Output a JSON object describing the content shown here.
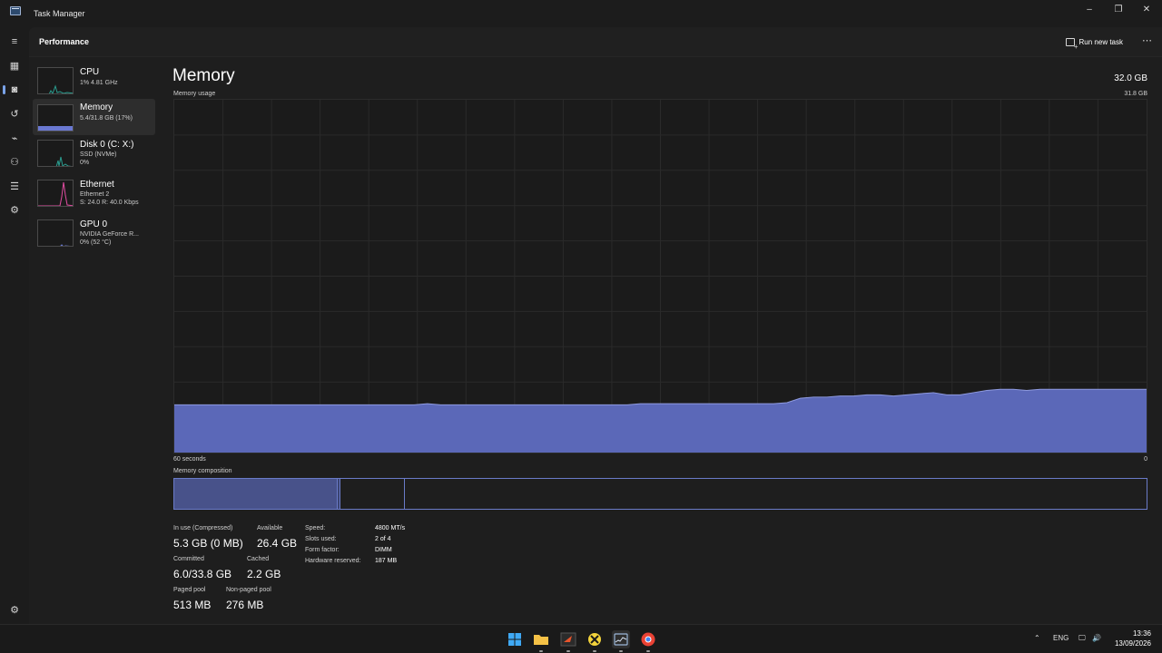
{
  "window": {
    "title": "Task Manager",
    "controls": {
      "minimize": "–",
      "restore": "❐",
      "close": "✕"
    }
  },
  "nav": [
    {
      "name": "hamburger-icon",
      "glyph": "≡"
    },
    {
      "name": "processes-icon",
      "glyph": "▦"
    },
    {
      "name": "performance-icon",
      "glyph": "◙",
      "active": true
    },
    {
      "name": "app-history-icon",
      "glyph": "↺"
    },
    {
      "name": "startup-apps-icon",
      "glyph": "⌁"
    },
    {
      "name": "users-icon",
      "glyph": "⚇"
    },
    {
      "name": "details-icon",
      "glyph": "☰"
    },
    {
      "name": "services-icon",
      "glyph": "⚙"
    }
  ],
  "settings_glyph": "⚙",
  "header": {
    "title": "Performance",
    "run_new_task": "Run new task",
    "more": "⋯"
  },
  "devices": [
    {
      "name": "CPU",
      "sub1": "1% 4.81 GHz",
      "sub2": ""
    },
    {
      "name": "Memory",
      "sub1": "5.4/31.8 GB (17%)",
      "sub2": "",
      "selected": true
    },
    {
      "name": "Disk 0 (C: X:)",
      "sub1": "SSD (NVMe)",
      "sub2": "0%"
    },
    {
      "name": "Ethernet",
      "sub1": "Ethernet 2",
      "sub2": "S: 24.0 R: 40.0 Kbps"
    },
    {
      "name": "GPU 0",
      "sub1": "NVIDIA GeForce R...",
      "sub2": "0% (52 °C)"
    }
  ],
  "memory": {
    "title": "Memory",
    "total": "32.0 GB",
    "usage_label": "Memory usage",
    "usage_max": "31.8 GB",
    "time_left": "60 seconds",
    "time_right": "0",
    "composition_label": "Memory composition",
    "graph": {
      "color": "#5b68b8",
      "line_color": "#8f9be0",
      "max_gb": 31.8,
      "usage_gb": [
        4.3,
        4.3,
        4.3,
        4.3,
        4.3,
        4.3,
        4.3,
        4.3,
        4.3,
        4.3,
        4.3,
        4.3,
        4.3,
        4.3,
        4.3,
        4.3,
        4.3,
        4.3,
        4.3,
        4.4,
        4.3,
        4.3,
        4.3,
        4.3,
        4.3,
        4.3,
        4.3,
        4.3,
        4.3,
        4.3,
        4.3,
        4.3,
        4.3,
        4.3,
        4.3,
        4.4,
        4.4,
        4.4,
        4.4,
        4.4,
        4.4,
        4.4,
        4.4,
        4.4,
        4.4,
        4.4,
        4.5,
        4.9,
        5.0,
        5.0,
        5.1,
        5.1,
        5.2,
        5.2,
        5.1,
        5.2,
        5.3,
        5.4,
        5.2,
        5.2,
        5.4,
        5.6,
        5.7,
        5.7,
        5.6,
        5.7,
        5.7,
        5.7,
        5.7,
        5.7,
        5.7,
        5.7,
        5.7,
        5.7
      ]
    },
    "composition": {
      "in_use_fraction": 0.168,
      "modified_fraction": 0.003,
      "standby_fraction": 0.066
    },
    "stats": [
      {
        "label": "In use (Compressed)",
        "value": "5.3 GB (0 MB)"
      },
      {
        "label": "Available",
        "value": "26.4 GB"
      },
      {
        "label": "Committed",
        "value": "6.0/33.8 GB"
      },
      {
        "label": "Cached",
        "value": "2.2 GB"
      },
      {
        "label": "Paged pool",
        "value": "513 MB"
      },
      {
        "label": "Non-paged pool",
        "value": "276 MB"
      }
    ],
    "specs": [
      {
        "label": "Speed:",
        "value": "4800 MT/s"
      },
      {
        "label": "Slots used:",
        "value": "2 of 4"
      },
      {
        "label": "Form factor:",
        "value": "DIMM"
      },
      {
        "label": "Hardware reserved:",
        "value": "187 MB"
      }
    ]
  },
  "thumb_colors": {
    "cpu": "#2a9d8f",
    "memory": "#6a78d1",
    "disk": "#2a9d8f",
    "ethernet": "#e04ca0",
    "gpu": "#6a78d1"
  },
  "taskbar": {
    "apps": [
      {
        "name": "start-button",
        "color": "#3fa9f5"
      },
      {
        "name": "file-explorer-icon",
        "color": "#f5c146",
        "open": true
      },
      {
        "name": "terminal-app-icon",
        "color": "#e8542c",
        "open": true
      },
      {
        "name": "xbox-app-icon",
        "color": "#f3d33b",
        "open": true
      },
      {
        "name": "task-manager-taskbar-icon",
        "color": "#9ab6d8",
        "open": true,
        "active": true
      },
      {
        "name": "chrome-icon",
        "color": "#e94235",
        "open": true
      }
    ],
    "tray": {
      "chevron": "⌃",
      "lang": "ENG",
      "network": "🖵",
      "volume": "🔊",
      "time": "13:36",
      "date": "13/09/2026"
    }
  }
}
